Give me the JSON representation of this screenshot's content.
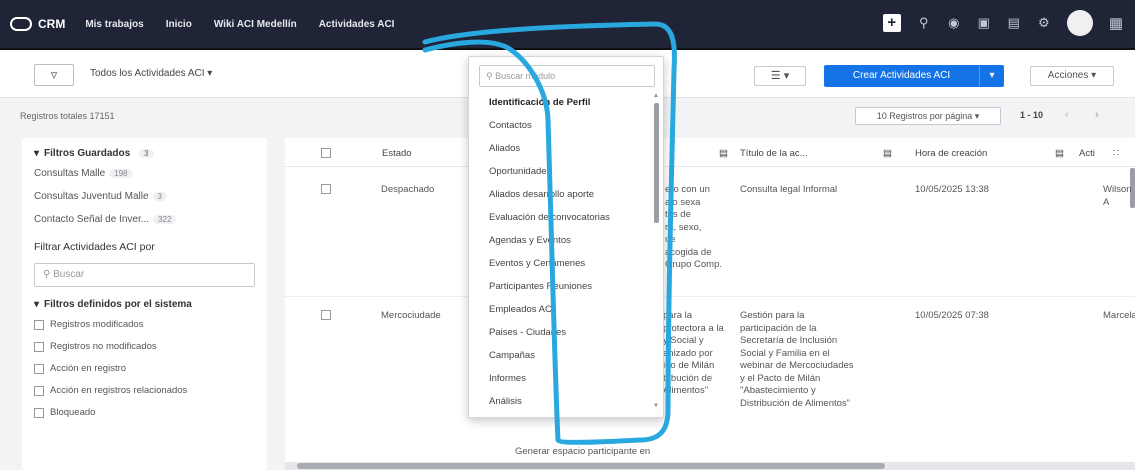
{
  "app": {
    "name": "CRM"
  },
  "nav": {
    "tabs": [
      "Mis trabajos",
      "Inicio",
      "Wiki ACI Medellín",
      "Actividades ACI"
    ]
  },
  "toolbar": {
    "filter_icon": "filter-icon",
    "view_selector": "Todos los Actividades ACI",
    "create_label": "Crear Actividades ACI",
    "actions_label": "Acciones"
  },
  "subbar": {
    "total_label": "Registros totales 17151",
    "per_page": "10 Registros por página",
    "range": "1 - 10"
  },
  "sidebar": {
    "saved_title": "Filtros Guardados",
    "saved_count": "3",
    "saved": [
      {
        "label": "Consultas Malle",
        "count": "198"
      },
      {
        "label": "Consultas Juventud Malle",
        "count": "3"
      },
      {
        "label": "Contacto Señal de Inver...",
        "count": "322"
      }
    ],
    "filter_by": "Filtrar Actividades ACI por",
    "search_placeholder": "Buscar",
    "system_title": "Filtros definidos por el sistema",
    "system_filters": [
      "Registros modificados",
      "Registros no modificados",
      "Acción en registro",
      "Acción en registros relacionados",
      "Bloqueado"
    ]
  },
  "table": {
    "headers": [
      "Estado",
      "Título de la ac...",
      "Hora de creación",
      "Acti"
    ],
    "rows": [
      {
        "estado": "Despachado",
        "desc": [
          "ero con un",
          "ajo sexa",
          "tos de",
          "ra, sexo,",
          "ue",
          "acogida de",
          "Grupo Comp."
        ],
        "titulo": [
          "Consulta legal Informal"
        ],
        "hora": "10/05/2025 13:38",
        "actor": "Wilson A"
      },
      {
        "estado": "Mercociudade",
        "desc": [
          "para la",
          "protectora a la",
          "y Social y",
          "anizado por",
          "ido de Milán",
          "tribución de",
          "Alimentos\""
        ],
        "titulo": [
          "Gestión para la",
          "participación de la",
          "Secretaría de Inclusión",
          "Social y Familia en el",
          "webinar de Mercociudades",
          "y el Pacto de Milán",
          "\"Abastecimiento y",
          "Distribución de Alimentos\""
        ],
        "hora": "10/05/2025 07:38",
        "actor": "Marcela"
      }
    ],
    "footer_text": "Generar espacio participante en"
  },
  "dropdown": {
    "search_placeholder": "Buscar módulo",
    "items": [
      "Identificación de Perfil",
      "Contactos",
      "Aliados",
      "Oportunidades",
      "Aliados desarrollo aporte",
      "Evaluación de convocatorias",
      "Agendas y Eventos",
      "Eventos y Certámenes",
      "Participantes Reuniones",
      "Empleados ACI",
      "Paises - Ciudades",
      "Campañas",
      "Informes",
      "Análisis"
    ]
  },
  "colors": {
    "nav_bg": "#1f2436",
    "accent": "#1473e6",
    "annotation": "#29a8e0"
  }
}
